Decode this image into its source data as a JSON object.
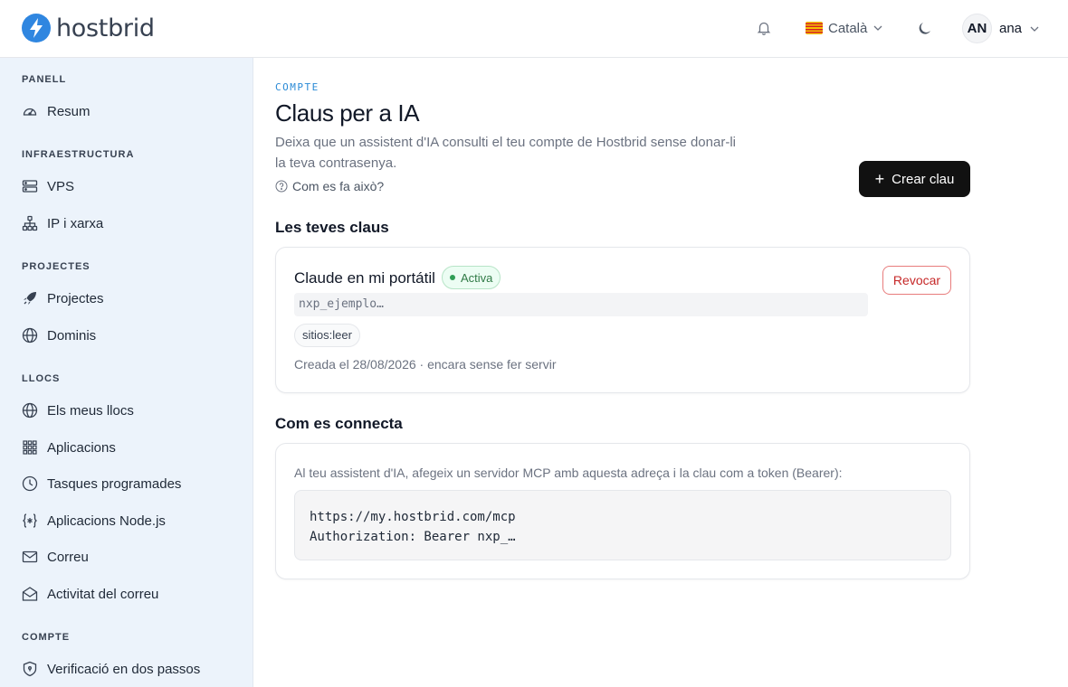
{
  "brand": {
    "name": "hostbrid",
    "accent": "#2f86e0"
  },
  "header": {
    "language": "Català",
    "user_initials": "AN",
    "user_name": "ana",
    "icons": [
      "bell-icon",
      "moon-icon",
      "chevron-down-icon"
    ]
  },
  "sidebar": {
    "sections": [
      {
        "title": "PANELL",
        "items": [
          {
            "label": "Resum",
            "icon": "dashboard-icon"
          }
        ]
      },
      {
        "title": "INFRAESTRUCTURA",
        "items": [
          {
            "label": "VPS",
            "icon": "server-icon"
          },
          {
            "label": "IP i xarxa",
            "icon": "network-icon"
          }
        ]
      },
      {
        "title": "PROJECTES",
        "items": [
          {
            "label": "Projectes",
            "icon": "rocket-icon"
          },
          {
            "label": "Dominis",
            "icon": "globe-icon"
          }
        ]
      },
      {
        "title": "LLOCS",
        "items": [
          {
            "label": "Els meus llocs",
            "icon": "globe-icon"
          },
          {
            "label": "Aplicacions",
            "icon": "grid-icon"
          },
          {
            "label": "Tasques programades",
            "icon": "clock-icon"
          },
          {
            "label": "Aplicacions Node.js",
            "icon": "braces-icon"
          },
          {
            "label": "Correu",
            "icon": "mail-icon"
          },
          {
            "label": "Activitat del correu",
            "icon": "mail-open-icon"
          }
        ]
      },
      {
        "title": "COMPTE",
        "items": [
          {
            "label": "Verificació en dos passos",
            "icon": "shield-icon"
          }
        ]
      }
    ]
  },
  "main": {
    "eyebrow": "COMPTE",
    "title": "Claus per a IA",
    "description": "Deixa que un assistent d'IA consulti el teu compte de Hostbrid sense donar-li la teva contrasenya.",
    "help_link": "Com es fa això?",
    "create_button": "Crear clau",
    "keys_heading": "Les teves claus",
    "keys": [
      {
        "name": "Claude en mi portátil",
        "status": "Activa",
        "token": "nxp_ejemplo…",
        "scope": "sitios:leer",
        "meta": "Creada el 28/08/2026 · encara sense fer servir",
        "revoke_label": "Revocar"
      }
    ],
    "connect_heading": "Com es connecta",
    "connect_text": "Al teu assistent d'IA, afegeix un servidor MCP amb aquesta adreça i la clau com a token (Bearer):",
    "code_lines": [
      "https://my.hostbrid.com/mcp",
      "Authorization: Bearer nxp_…"
    ]
  }
}
